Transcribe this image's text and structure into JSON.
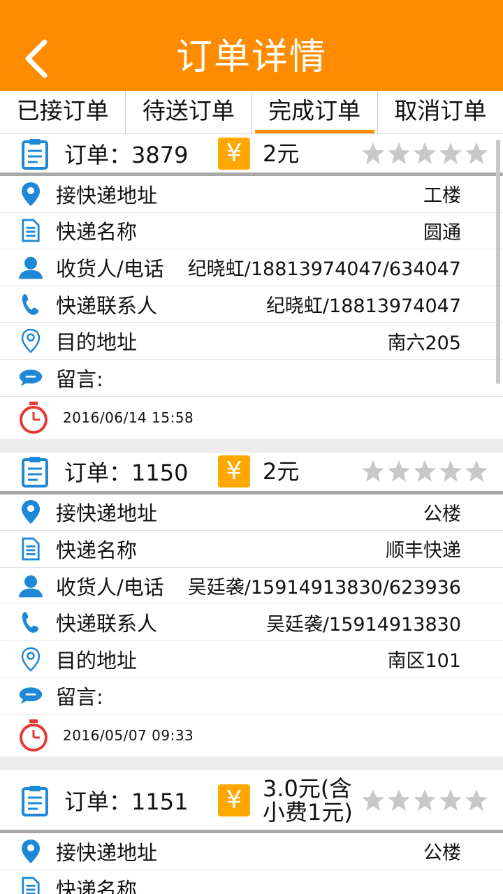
{
  "header": {
    "title": "订单详情",
    "back_icon": "chevron-left-icon"
  },
  "tabs": [
    {
      "label": "已接订单"
    },
    {
      "label": "待送订单"
    },
    {
      "label": "完成订单",
      "active": true
    },
    {
      "label": "取消订单"
    }
  ],
  "colors": {
    "accent": "#ff8c00",
    "yen_badge": "#ffa800",
    "icon_blue": "#1e88d8",
    "timer_red": "#e53935",
    "star_gray": "#c8c8c8"
  },
  "currency_symbol": "¥",
  "orders": [
    {
      "order_text": "订单：3879",
      "price": "2元",
      "rating": 0,
      "rows": [
        {
          "label": "接快递地址",
          "value": "工楼",
          "icon": "location-pin-icon"
        },
        {
          "label": "快递名称",
          "value": "圆通",
          "icon": "document-icon"
        },
        {
          "label": "收货人/电话",
          "value": "纪晓虹/18813974047/634047",
          "icon": "person-icon"
        },
        {
          "label": "快递联系人",
          "value": "纪晓虹/18813974047",
          "icon": "phone-icon"
        },
        {
          "label": "目的地址",
          "value": "南六205",
          "icon": "location-outline-icon"
        },
        {
          "label": "留言:",
          "value": "",
          "icon": "message-bubble-icon"
        }
      ],
      "time": "2016/06/14    15:58"
    },
    {
      "order_text": "订单：1150",
      "price": "2元",
      "rating": 0,
      "rows": [
        {
          "label": "接快递地址",
          "value": "公楼",
          "icon": "location-pin-icon"
        },
        {
          "label": "快递名称",
          "value": "顺丰快递",
          "icon": "document-icon"
        },
        {
          "label": "收货人/电话",
          "value": "吴廷袭/15914913830/623936",
          "icon": "person-icon"
        },
        {
          "label": "快递联系人",
          "value": "吴廷袭/15914913830",
          "icon": "phone-icon"
        },
        {
          "label": "目的地址",
          "value": "南区101",
          "icon": "location-outline-icon"
        },
        {
          "label": "留言:",
          "value": "",
          "icon": "message-bubble-icon"
        }
      ],
      "time": "2016/05/07    09:33"
    },
    {
      "order_text": "订单：1151",
      "price": "3.0元(含小费1元)",
      "rating": 0,
      "rows": [
        {
          "label": "接快递地址",
          "value": "公楼",
          "icon": "location-pin-icon"
        },
        {
          "label": "快递名称",
          "value": "",
          "icon": "document-icon"
        }
      ],
      "time": ""
    }
  ]
}
